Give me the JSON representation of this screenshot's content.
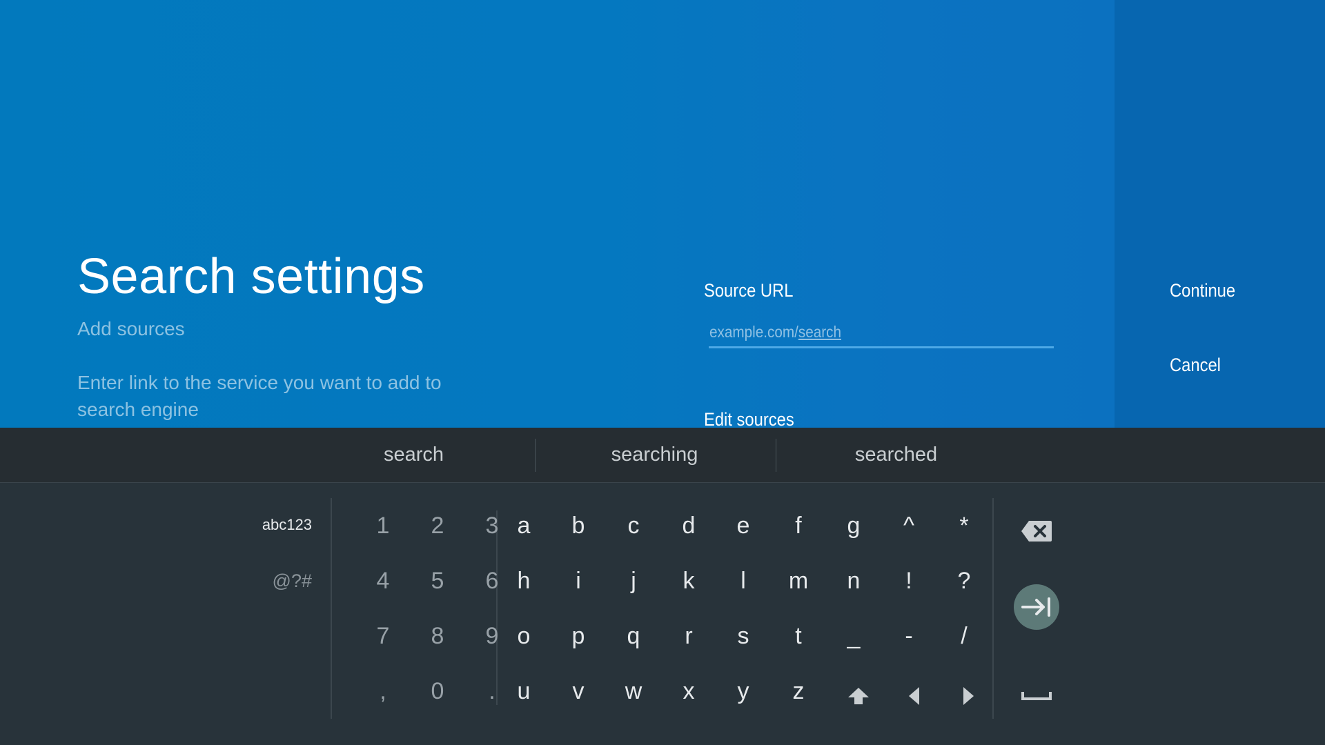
{
  "header": {
    "title": "Search settings",
    "subtitle": "Add sources",
    "description": "Enter link to the service you want to add to search engine"
  },
  "form": {
    "source_url_label": "Source URL",
    "url_placeholder_prefix": "example.com/",
    "url_placeholder_suffix": "search",
    "edit_sources_label": "Edit sources"
  },
  "actions": {
    "continue": "Continue",
    "cancel": "Cancel"
  },
  "suggestions": [
    "search",
    "searching",
    "searched"
  ],
  "keyboard": {
    "modes": {
      "alpha": "abc123",
      "symbols": "@?#"
    },
    "numpad": [
      [
        "1",
        "2",
        "3"
      ],
      [
        "4",
        "5",
        "6"
      ],
      [
        "7",
        "8",
        "9"
      ],
      [
        ",",
        "0",
        "."
      ]
    ],
    "letters": [
      [
        "a",
        "b",
        "c",
        "d",
        "e",
        "f",
        "g",
        "^",
        "*"
      ],
      [
        "h",
        "i",
        "j",
        "k",
        "l",
        "m",
        "n",
        "!",
        "?"
      ],
      [
        "o",
        "p",
        "q",
        "r",
        "s",
        "t",
        "_",
        "-",
        "/"
      ],
      [
        "u",
        "v",
        "w",
        "x",
        "y",
        "z"
      ]
    ],
    "icons": [
      "shift-icon",
      "arrow-left-icon",
      "arrow-right-icon",
      "backspace-icon",
      "next-field-icon",
      "space-icon"
    ]
  },
  "colors": {
    "background_top": "#0478c0",
    "action_panel": "#0766b0",
    "keyboard_bg": "#28333a",
    "input_underline": "#4da9e6",
    "next_button": "#5d7a78"
  }
}
